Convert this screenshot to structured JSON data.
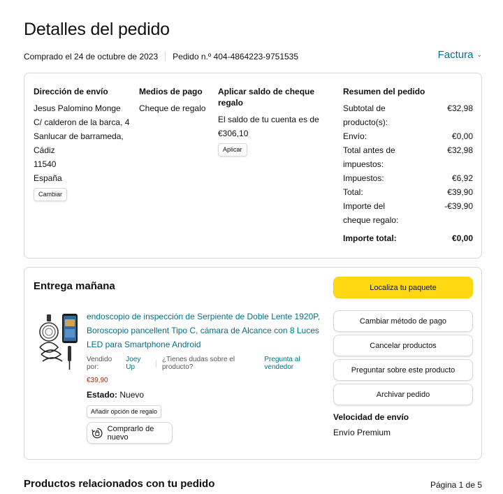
{
  "header": {
    "title": "Detalles del pedido",
    "purchased": "Comprado el 24 de octubre de 2023",
    "order_number": "Pedido n.º 404-4864223-9751535",
    "invoice_label": "Factura"
  },
  "shipping": {
    "title": "Dirección de envío",
    "name": "Jesus Palomino Monge",
    "street": "C/ calderon de la barca, 4",
    "city": "Sanlucar de barrameda, Cádiz",
    "postal": "11540",
    "country": "España",
    "change_label": "Cambiar"
  },
  "payment": {
    "title": "Medios de pago",
    "method": "Cheque de regalo"
  },
  "gift_balance": {
    "title": "Aplicar saldo de cheque regalo",
    "text": "El saldo de tu cuenta es de €306,10",
    "apply_label": "Aplicar"
  },
  "summary": {
    "title": "Resumen del pedido",
    "rows": [
      {
        "label": "Subtotal de producto(s):",
        "value": "€32,98"
      },
      {
        "label": "Envío:",
        "value": "€0,00"
      },
      {
        "label": "Total antes de impuestos:",
        "value": "€32,98"
      },
      {
        "label": "Impuestos:",
        "value": "€6,92"
      },
      {
        "label": "Total:",
        "value": "€39,90"
      },
      {
        "label": "Importe del cheque regalo:",
        "value": "-€39,90"
      }
    ],
    "grand_total_label": "Importe total:",
    "grand_total_value": "€0,00"
  },
  "delivery": {
    "title": "Entrega mañana",
    "product_title": "endoscopio de inspección de Serpiente de Doble Lente 1920P, Boroscopio pancellent Tipo C, cámara de Alcance con 8 Luces LED para Smartphone Android",
    "sold_by_label": "Vendido por:",
    "seller": "Joey Up",
    "question_text": "¿Tienes dudas sobre el producto?",
    "ask_seller": "Pregunta al vendedor",
    "price": "€39,90",
    "condition_label": "Estado:",
    "condition_value": "Nuevo",
    "gift_option_label": "Añadir opción de regalo",
    "buy_again_label": "Comprarlo de nuevo"
  },
  "actions": {
    "track": "Localiza tu paquete",
    "change_payment": "Cambiar método de pago",
    "cancel": "Cancelar productos",
    "ask_product": "Preguntar sobre este producto",
    "archive": "Archivar pedido",
    "speed_title": "Velocidad de envío",
    "speed_value": "Envío Premium"
  },
  "related": {
    "title": "Productos relacionados con tu pedido",
    "page": "Página 1 de 5"
  },
  "colors": {
    "link": "#007185",
    "price": "#b12704",
    "primary_button": "#ffd814",
    "border": "#d5d9d9"
  }
}
